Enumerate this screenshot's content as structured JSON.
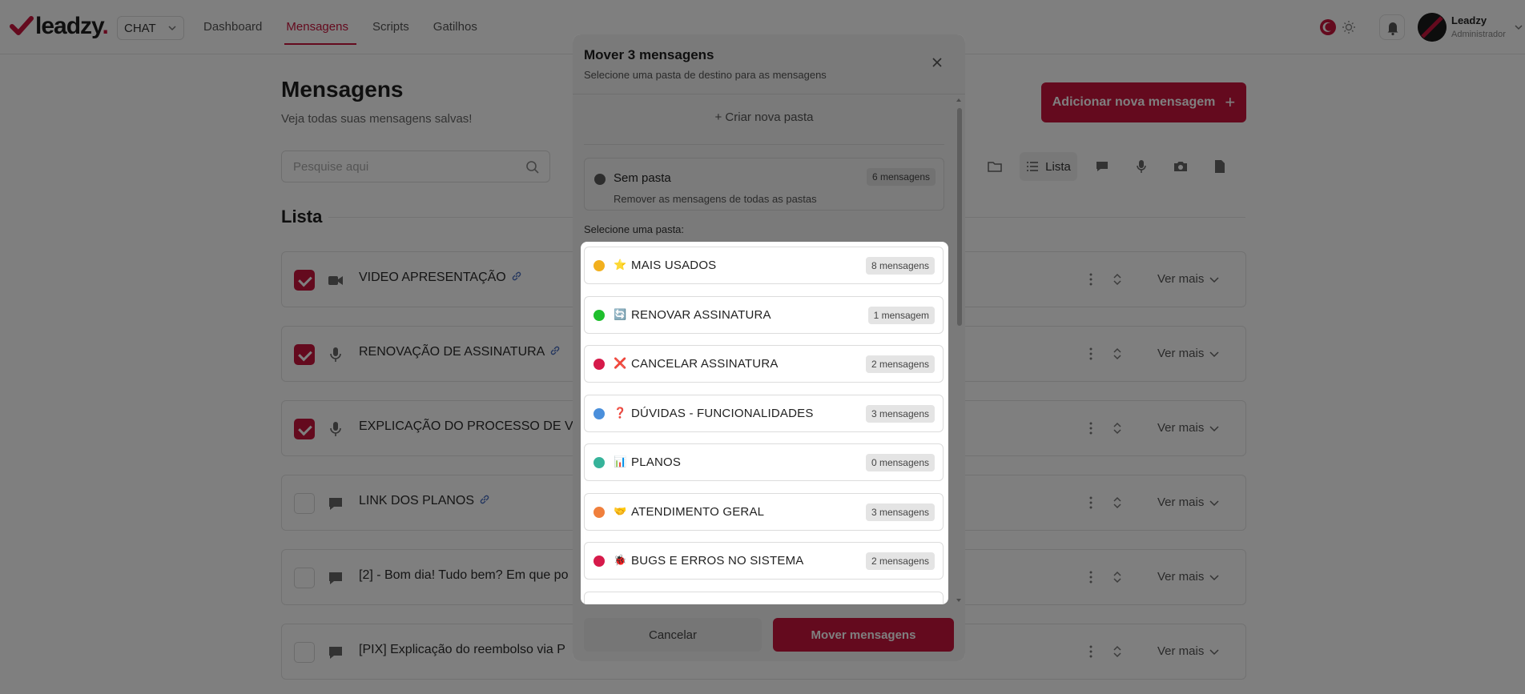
{
  "app": {
    "logo_text": "leadzy",
    "logo_dot": ".",
    "product_select": "CHAT"
  },
  "nav": {
    "items": [
      {
        "label": "Dashboard",
        "active": false
      },
      {
        "label": "Mensagens",
        "active": true
      },
      {
        "label": "Scripts",
        "active": false
      },
      {
        "label": "Gatilhos",
        "active": false
      }
    ]
  },
  "user": {
    "name": "Leadzy",
    "role": "Administrador"
  },
  "page": {
    "title": "Mensagens",
    "subtitle": "Veja todas suas mensagens salvas!",
    "add_button": "Adicionar nova mensagem",
    "search_placeholder": "Pesquise aqui",
    "view_list_label": "Lista",
    "section_title": "Lista",
    "see_more": "Ver mais"
  },
  "messages": [
    {
      "title": "VIDEO APRESENTAÇÃO",
      "type": "video-icon",
      "checked": true,
      "has_link": true
    },
    {
      "title": "RENOVAÇÃO DE ASSINATURA",
      "type": "microphone-icon",
      "checked": true,
      "has_link": true
    },
    {
      "title": "EXPLICAÇÃO DO PROCESSO DE VE",
      "type": "microphone-icon",
      "checked": true,
      "has_link": false
    },
    {
      "title": "LINK DOS PLANOS",
      "type": "chat-bubble-icon",
      "checked": false,
      "has_link": true
    },
    {
      "title": "[2] - Bom dia! Tudo bem? Em que po",
      "type": "chat-bubble-icon",
      "checked": false,
      "has_link": false
    },
    {
      "title": "[PIX] Explicação do reembolso via P",
      "type": "chat-bubble-icon",
      "checked": false,
      "has_link": false
    }
  ],
  "modal": {
    "title": "Mover 3 mensagens",
    "subtitle": "Selecione uma pasta de destino para as mensagens",
    "create_folder": "+ Criar nova pasta",
    "no_folder": {
      "name": "Sem pasta",
      "description": "Remover as mensagens de todas as pastas",
      "count": "6 mensagens",
      "color": "#5a5a5a"
    },
    "select_label": "Selecione uma pasta:",
    "folders": [
      {
        "emoji": "⭐",
        "name": "MAIS USADOS",
        "count": "8 mensagens",
        "color": "#f2b01e"
      },
      {
        "emoji": "🔄",
        "name": "RENOVAR ASSINATURA",
        "count": "1 mensagem",
        "color": "#1fbf2d"
      },
      {
        "emoji": "❌",
        "name": "CANCELAR ASSINATURA",
        "count": "2 mensagens",
        "color": "#d61a4a"
      },
      {
        "emoji": "❓",
        "name": "DÚVIDAS - FUNCIONALIDADES",
        "count": "3 mensagens",
        "color": "#4a8fdb"
      },
      {
        "emoji": "📊",
        "name": "PLANOS",
        "count": "0 mensagens",
        "color": "#36b39a"
      },
      {
        "emoji": "🤝",
        "name": "ATENDIMENTO GERAL",
        "count": "3 mensagens",
        "color": "#f07f3c"
      },
      {
        "emoji": "🐞",
        "name": "BUGS E ERROS NO SISTEMA",
        "count": "2 mensagens",
        "color": "#d61a4a"
      }
    ],
    "cancel_button": "Cancelar",
    "move_button": "Mover mensagens"
  },
  "colors": {
    "brand": "#c8143c"
  }
}
